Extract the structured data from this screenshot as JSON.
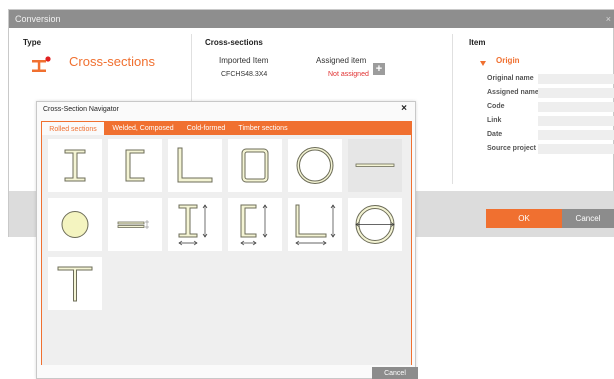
{
  "window": {
    "title": "Conversion",
    "close_glyph": "×"
  },
  "type_section": {
    "heading": "Type",
    "icon": "i-beam-icon",
    "label": "Cross-sections"
  },
  "cross_sections": {
    "heading": "Cross-sections",
    "col_imported": "Imported Item",
    "col_assigned": "Assigned item",
    "imported_value": "CFCHS48.3X4",
    "assigned_value": "Not assigned",
    "add_glyph": "+"
  },
  "item_section": {
    "heading": "Item",
    "group_label": "Origin",
    "properties": [
      {
        "label": "Original name"
      },
      {
        "label": "Assigned name"
      },
      {
        "label": "Code"
      },
      {
        "label": "Link"
      },
      {
        "label": "Date"
      },
      {
        "label": "Source project"
      }
    ]
  },
  "footer": {
    "ok_label": "OK",
    "cancel_label": "Cancel"
  },
  "navigator": {
    "title": "Cross-Section Navigator",
    "close_glyph": "×",
    "tabs": [
      {
        "label": "Rolled sections",
        "active": true
      },
      {
        "label": "Welded, Composed",
        "active": false
      },
      {
        "label": "Cold-formed",
        "active": false
      },
      {
        "label": "Timber sections",
        "active": false
      }
    ],
    "tiles": [
      {
        "icon": "i-section-icon"
      },
      {
        "icon": "channel-section-icon"
      },
      {
        "icon": "angle-section-icon"
      },
      {
        "icon": "rectangular-hollow-section-icon"
      },
      {
        "icon": "circular-hollow-section-icon"
      },
      {
        "icon": "flat-bar-icon",
        "selected": true
      },
      {
        "icon": "round-bar-icon"
      },
      {
        "icon": "double-flat-bar-icon"
      },
      {
        "icon": "i-section-dimensioned-icon"
      },
      {
        "icon": "channel-section-dimensioned-icon"
      },
      {
        "icon": "angle-section-dimensioned-icon"
      },
      {
        "icon": "circular-hollow-dimensioned-icon"
      },
      {
        "icon": "t-section-icon"
      }
    ],
    "cancel_label": "Cancel"
  },
  "colors": {
    "accent": "#f07030",
    "title_bar": "#8e8e8e",
    "error_text": "#e03030",
    "section_fill": "#f4f4d4",
    "section_stroke": "#6c6c58"
  }
}
